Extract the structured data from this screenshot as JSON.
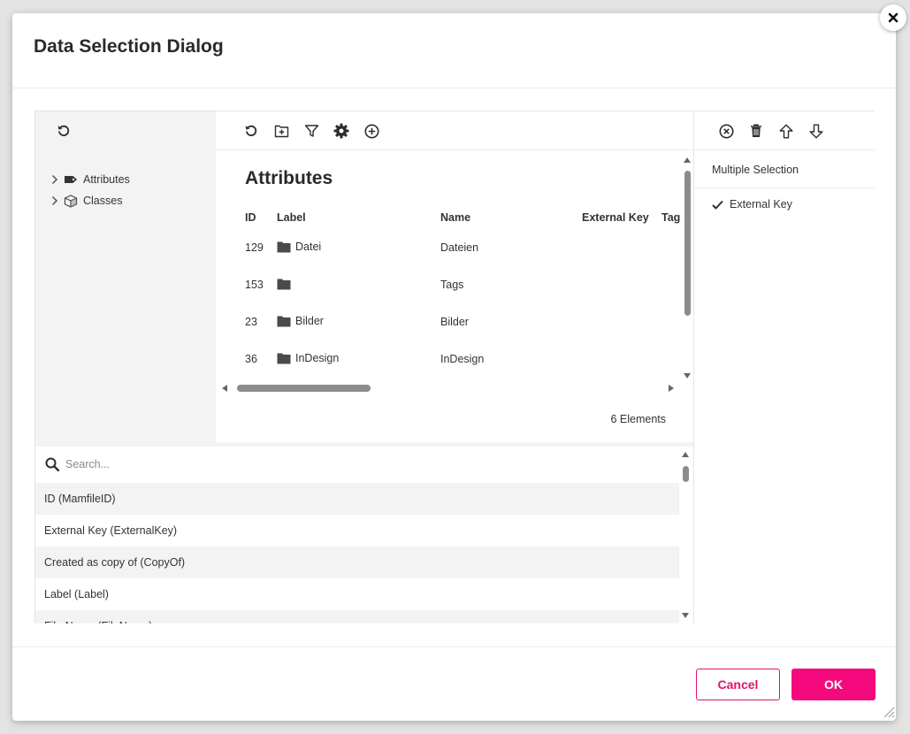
{
  "dialog": {
    "title": "Data Selection Dialog"
  },
  "tree": {
    "items": [
      {
        "label": "Attributes",
        "icon": "tag-icon"
      },
      {
        "label": "Classes",
        "icon": "cube-icon"
      }
    ]
  },
  "grid": {
    "title": "Attributes",
    "columns": [
      "ID",
      "Label",
      "Name",
      "External Key",
      "Tag"
    ],
    "rows": [
      {
        "id": "129",
        "label": "Datei",
        "name": "Dateien"
      },
      {
        "id": "153",
        "label": "",
        "name": "Tags"
      },
      {
        "id": "23",
        "label": "Bilder",
        "name": "Bilder"
      },
      {
        "id": "36",
        "label": "InDesign",
        "name": "InDesign"
      }
    ],
    "count_text": "6 Elements"
  },
  "attributes": {
    "search_placeholder": "Search...",
    "items": [
      "ID (MamfileID)",
      "External Key (ExternalKey)",
      "Created as copy of (CopyOf)",
      "Label (Label)",
      "File Name (FileName)"
    ]
  },
  "selection": {
    "header": "Multiple Selection",
    "items": [
      "External Key"
    ]
  },
  "footer": {
    "cancel_label": "Cancel",
    "ok_label": "OK"
  },
  "colors": {
    "accent": "#f50a7d",
    "accent_border": "#e2136e",
    "pane_bg": "#f3f3f3",
    "icon": "#2d2d2d"
  }
}
